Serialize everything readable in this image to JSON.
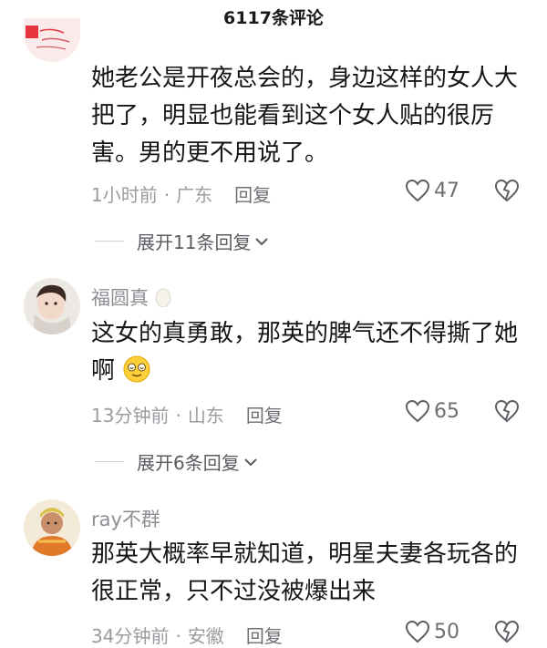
{
  "header": {
    "title": "6117条评论"
  },
  "comments": [
    {
      "username": "",
      "text": "她老公是开夜总会的，身边这样的女人大把了，明显也能看到这个女人贴的很厉害。男的更不用说了。",
      "time": "1小时前",
      "location": "广东",
      "reply_label": "回复",
      "likes": "47",
      "expand_label": "展开11条回复"
    },
    {
      "username": "福圆真",
      "text": "这女的真勇敢，那英的脾气还不得撕了她啊",
      "time": "13分钟前",
      "location": "山东",
      "reply_label": "回复",
      "likes": "65",
      "expand_label": "展开6条回复"
    },
    {
      "username": "ray不群",
      "text": "那英大概率早就知道，明星夫妻各玩各的很正常，只不过没被爆出来",
      "time": "34分钟前",
      "location": "安徽",
      "reply_label": "回复",
      "likes": "50"
    }
  ],
  "colors": {
    "meta": "#9a9ca1",
    "text": "#161616",
    "accent_red": "#e8343f"
  },
  "icons": [
    "heart-outline-icon",
    "dislike-heart-icon",
    "chevron-down-icon",
    "egg-emoji-icon",
    "dizzy-face-emoji-icon"
  ]
}
